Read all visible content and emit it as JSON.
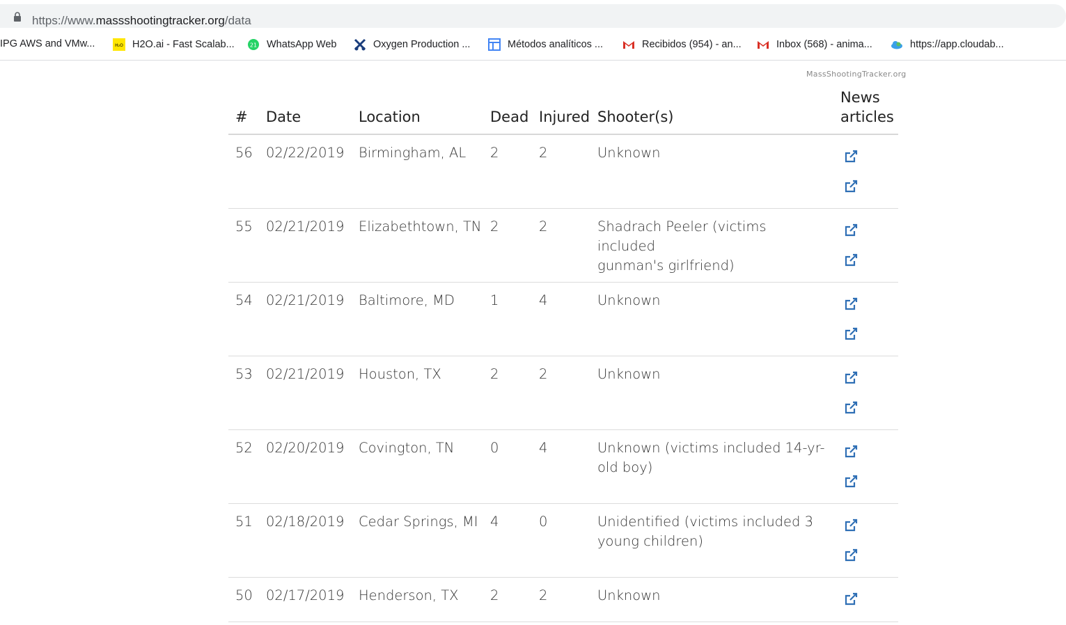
{
  "browser": {
    "url_prefix": "https://www.",
    "url_domain": "massshootingtracker.org",
    "url_path": "/data"
  },
  "bookmarks": [
    {
      "label": "IPG AWS and VMw...",
      "icon": "none"
    },
    {
      "label": "H2O.ai - Fast Scalab...",
      "icon": "h2o-icon"
    },
    {
      "label": "WhatsApp Web",
      "icon": "whatsapp-icon"
    },
    {
      "label": "Oxygen Production ...",
      "icon": "oxygen-icon"
    },
    {
      "label": "Métodos analíticos ...",
      "icon": "docs-icon"
    },
    {
      "label": "Recibidos (954) - an...",
      "icon": "gmail-icon"
    },
    {
      "label": "Inbox (568) - anima...",
      "icon": "gmail-icon"
    },
    {
      "label": "https://app.cloudab...",
      "icon": "cloud-icon"
    }
  ],
  "site_brand": "MassShootingTracker.org",
  "table": {
    "headers": {
      "num": "#",
      "date": "Date",
      "location": "Location",
      "dead": "Dead",
      "injured": "Injured",
      "shooter": "Shooter(s)",
      "news_line1": "News",
      "news_line2": "articles"
    },
    "rows": [
      {
        "num": "56",
        "date": "02/22/2019",
        "location": "Birmingham, AL",
        "dead": "2",
        "injured": "2",
        "shooter_line1": "Unknown",
        "shooter_line2": "",
        "links": 2
      },
      {
        "num": "55",
        "date": "02/21/2019",
        "location": "Elizabethtown, TN",
        "dead": "2",
        "injured": "2",
        "shooter_line1": "Shadrach Peeler (victims included",
        "shooter_line2": "gunman's girlfriend)",
        "links": 2
      },
      {
        "num": "54",
        "date": "02/21/2019",
        "location": "Baltimore, MD",
        "dead": "1",
        "injured": "4",
        "shooter_line1": "Unknown",
        "shooter_line2": "",
        "links": 2
      },
      {
        "num": "53",
        "date": "02/21/2019",
        "location": "Houston, TX",
        "dead": "2",
        "injured": "2",
        "shooter_line1": "Unknown",
        "shooter_line2": "",
        "links": 2
      },
      {
        "num": "52",
        "date": "02/20/2019",
        "location": "Covington, TN",
        "dead": "0",
        "injured": "4",
        "shooter_line1": "Unknown (victims included 14-yr-",
        "shooter_line2": "old boy)",
        "links": 2
      },
      {
        "num": "51",
        "date": "02/18/2019",
        "location": "Cedar Springs, MI",
        "dead": "4",
        "injured": "0",
        "shooter_line1": "Unidentified (victims included 3",
        "shooter_line2": "young children)",
        "links": 2
      },
      {
        "num": "50",
        "date": "02/17/2019",
        "location": "Henderson, TX",
        "dead": "2",
        "injured": "2",
        "shooter_line1": "Unknown",
        "shooter_line2": "",
        "links": 1
      }
    ]
  },
  "colors": {
    "link_icon": "#2f6fb5",
    "gmail_red": "#d93025",
    "whatsapp_green": "#25d366",
    "h2o_yellow": "#ffe600"
  }
}
